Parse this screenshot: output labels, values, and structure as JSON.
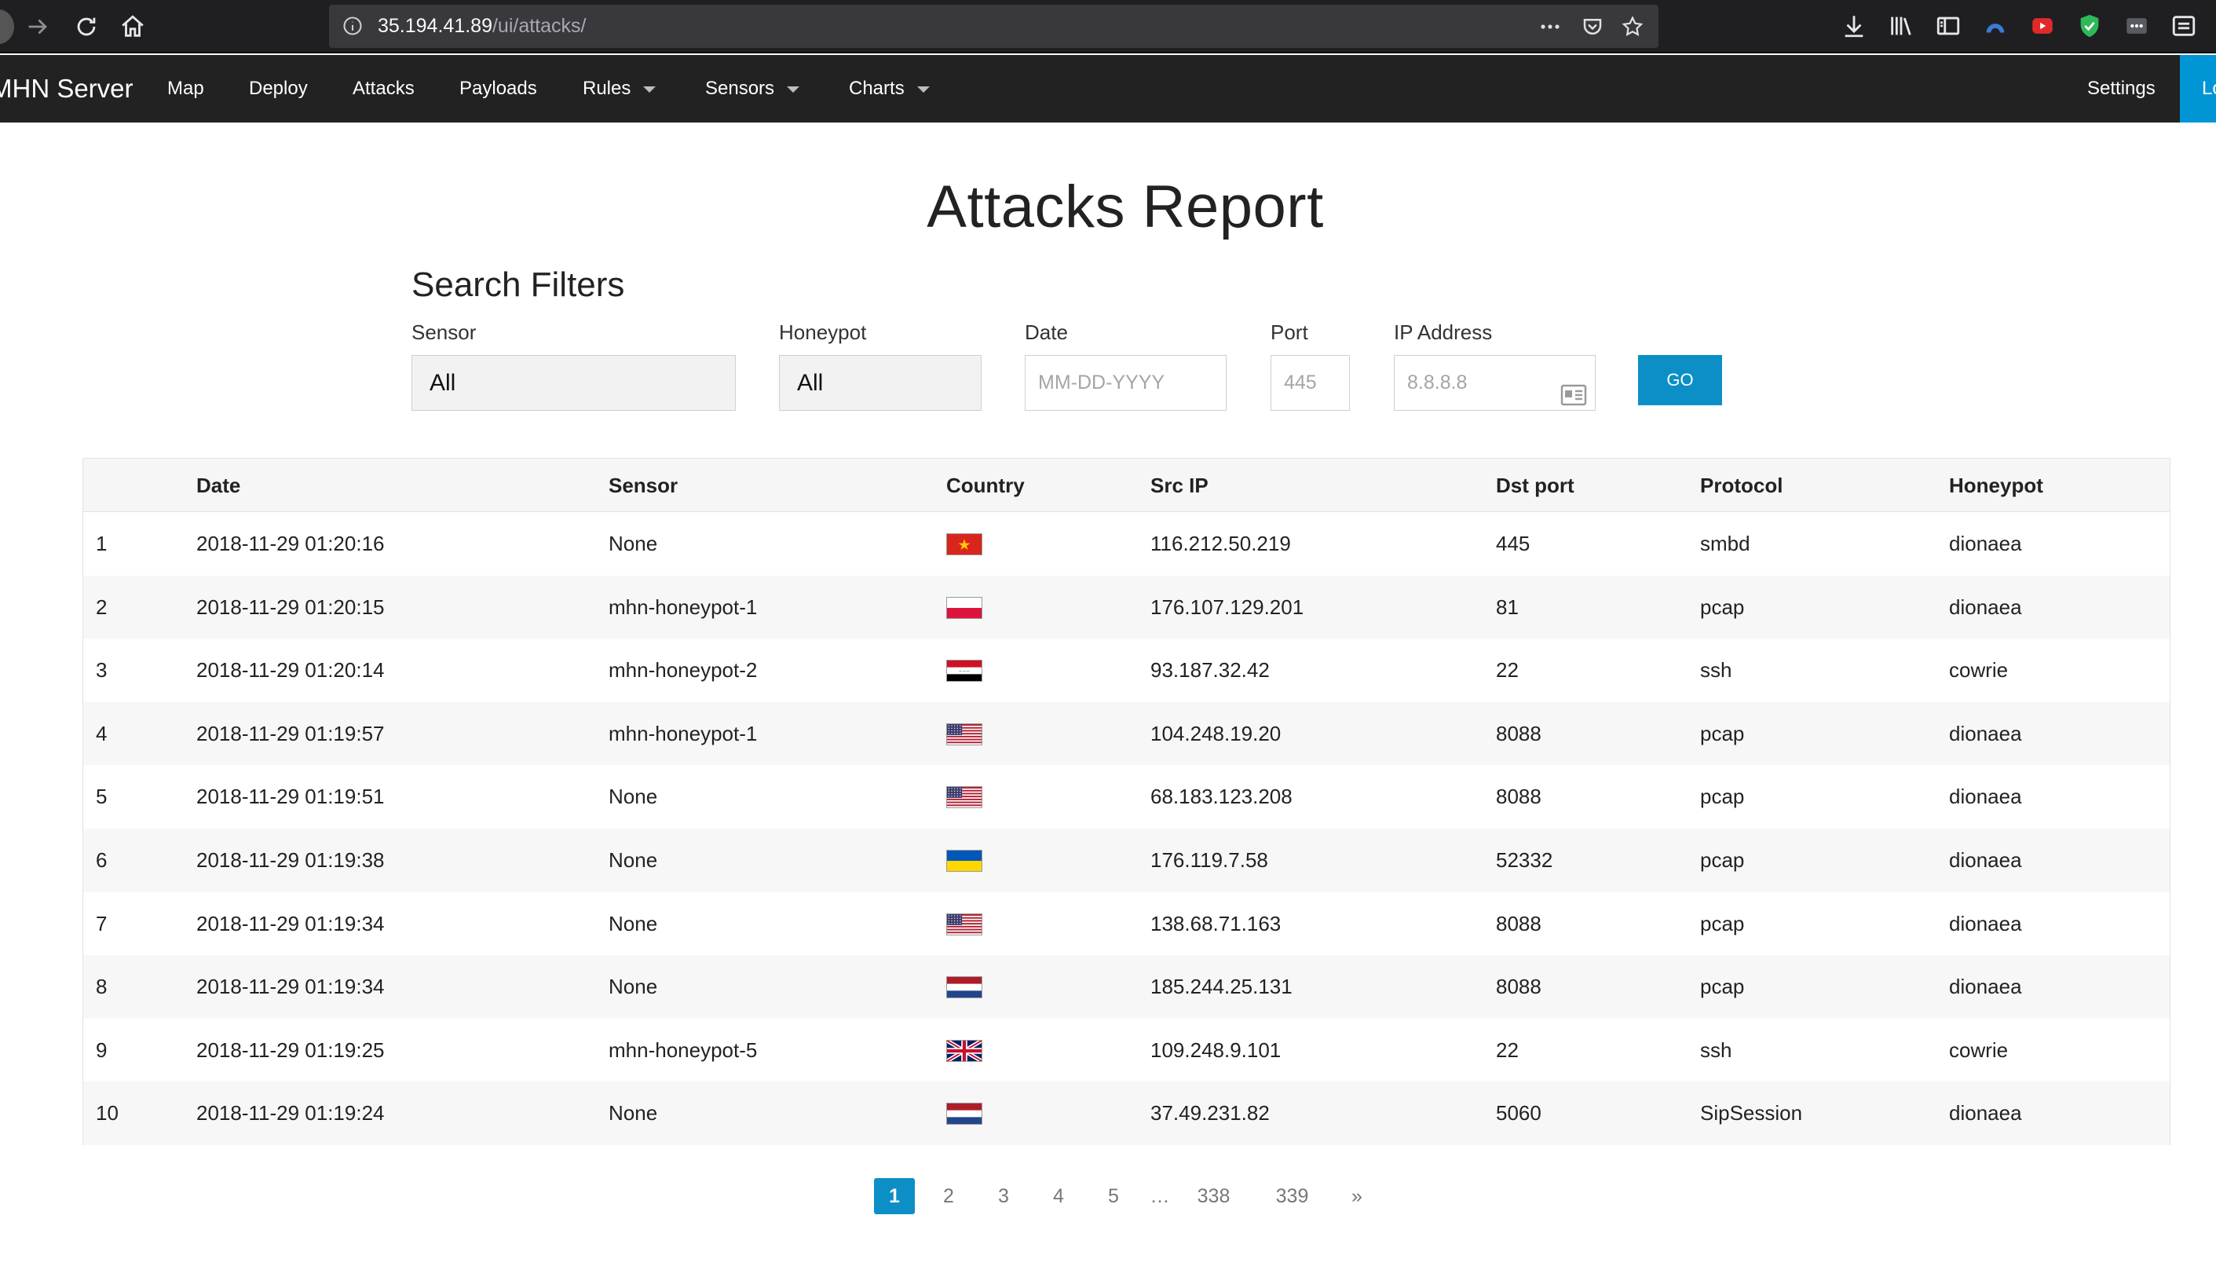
{
  "browser": {
    "url_host": "35.194.41.89",
    "url_path": "/ui/attacks/"
  },
  "navbar": {
    "brand": "MHN Server",
    "items": [
      {
        "label": "Map"
      },
      {
        "label": "Deploy"
      },
      {
        "label": "Attacks"
      },
      {
        "label": "Payloads"
      },
      {
        "label": "Rules"
      },
      {
        "label": "Sensors"
      },
      {
        "label": "Charts"
      }
    ],
    "settings": "Settings",
    "login": "Lo"
  },
  "page": {
    "title": "Attacks Report"
  },
  "filters": {
    "title": "Search Filters",
    "sensor_label": "Sensor",
    "sensor_value": "All",
    "honeypot_label": "Honeypot",
    "honeypot_value": "All",
    "date_label": "Date",
    "date_placeholder": "MM-DD-YYYY",
    "port_label": "Port",
    "port_placeholder": "445",
    "ip_label": "IP Address",
    "ip_placeholder": "8.8.8.8",
    "go_label": "GO"
  },
  "table": {
    "headers": [
      "",
      "Date",
      "Sensor",
      "Country",
      "Src IP",
      "Dst port",
      "Protocol",
      "Honeypot"
    ],
    "rows": [
      {
        "n": "1",
        "date": "2018-11-29 01:20:16",
        "sensor": "None",
        "country": "vn",
        "src": "116.212.50.219",
        "port": "445",
        "proto": "smbd",
        "honeypot": "dionaea"
      },
      {
        "n": "2",
        "date": "2018-11-29 01:20:15",
        "sensor": "mhn-honeypot-1",
        "country": "pl",
        "src": "176.107.129.201",
        "port": "81",
        "proto": "pcap",
        "honeypot": "dionaea"
      },
      {
        "n": "3",
        "date": "2018-11-29 01:20:14",
        "sensor": "mhn-honeypot-2",
        "country": "iq",
        "src": "93.187.32.42",
        "port": "22",
        "proto": "ssh",
        "honeypot": "cowrie"
      },
      {
        "n": "4",
        "date": "2018-11-29 01:19:57",
        "sensor": "mhn-honeypot-1",
        "country": "us",
        "src": "104.248.19.20",
        "port": "8088",
        "proto": "pcap",
        "honeypot": "dionaea"
      },
      {
        "n": "5",
        "date": "2018-11-29 01:19:51",
        "sensor": "None",
        "country": "us",
        "src": "68.183.123.208",
        "port": "8088",
        "proto": "pcap",
        "honeypot": "dionaea"
      },
      {
        "n": "6",
        "date": "2018-11-29 01:19:38",
        "sensor": "None",
        "country": "ua",
        "src": "176.119.7.58",
        "port": "52332",
        "proto": "pcap",
        "honeypot": "dionaea"
      },
      {
        "n": "7",
        "date": "2018-11-29 01:19:34",
        "sensor": "None",
        "country": "us",
        "src": "138.68.71.163",
        "port": "8088",
        "proto": "pcap",
        "honeypot": "dionaea"
      },
      {
        "n": "8",
        "date": "2018-11-29 01:19:34",
        "sensor": "None",
        "country": "nl",
        "src": "185.244.25.131",
        "port": "8088",
        "proto": "pcap",
        "honeypot": "dionaea"
      },
      {
        "n": "9",
        "date": "2018-11-29 01:19:25",
        "sensor": "mhn-honeypot-5",
        "country": "gb",
        "src": "109.248.9.101",
        "port": "22",
        "proto": "ssh",
        "honeypot": "cowrie"
      },
      {
        "n": "10",
        "date": "2018-11-29 01:19:24",
        "sensor": "None",
        "country": "nl",
        "src": "37.49.231.82",
        "port": "5060",
        "proto": "SipSession",
        "honeypot": "dionaea"
      }
    ]
  },
  "pagination": {
    "pages": [
      "1",
      "2",
      "3",
      "4",
      "5",
      "…",
      "338",
      "339",
      "»"
    ],
    "current": "1"
  }
}
